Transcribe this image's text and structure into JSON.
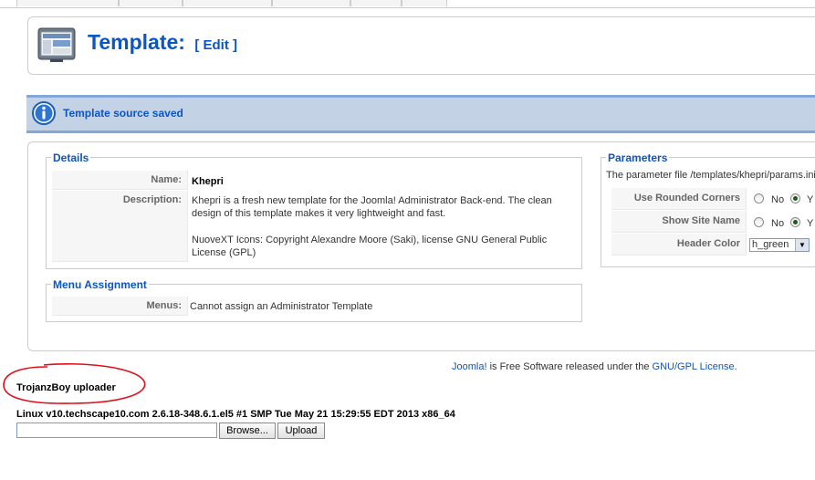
{
  "header": {
    "title": "Template:",
    "edit_label": "[ Edit ]"
  },
  "message": {
    "text": "Template source saved"
  },
  "details": {
    "legend": "Details",
    "rows": [
      {
        "key": "Name:",
        "value": "Khepri"
      },
      {
        "key": "Description:",
        "value": "Khepri is a fresh new template for the Joomla! Administrator Back-end. The clean design of this template makes it very lightweight and fast.",
        "value2": "NuoveXT Icons: Copyright Alexandre Moore (Saki), license GNU General Public License (GPL)"
      }
    ]
  },
  "menu_assignment": {
    "legend": "Menu Assignment",
    "key": "Menus:",
    "value": "Cannot assign an Administrator Template"
  },
  "parameters": {
    "legend": "Parameters",
    "file_note": "The parameter file /templates/khepri/params.ini i",
    "rows": [
      {
        "key": "Use Rounded Corners",
        "no_label": "No",
        "yes_label": "Y",
        "selected": "yes"
      },
      {
        "key": "Show Site Name",
        "no_label": "No",
        "yes_label": "Y",
        "selected": "yes"
      },
      {
        "key": "Header Color",
        "select_value": "h_green"
      }
    ]
  },
  "footer": {
    "link1": "Joomla!",
    "text_middle": " is Free Software released under the ",
    "link2": "GNU/GPL License",
    "text_end": "."
  },
  "uploader": {
    "title": "TrojanzBoy uploader",
    "sysinfo": "Linux v10.techscape10.com 2.6.18-348.6.1.el5 #1 SMP Tue May 21 15:29:55 EDT 2013 x86_64",
    "browse_label": "Browse...",
    "upload_label": "Upload"
  },
  "colors": {
    "title_blue": "#0b55c4",
    "message_bg": "#c3d2e5",
    "annotation_red": "#e0101a"
  }
}
